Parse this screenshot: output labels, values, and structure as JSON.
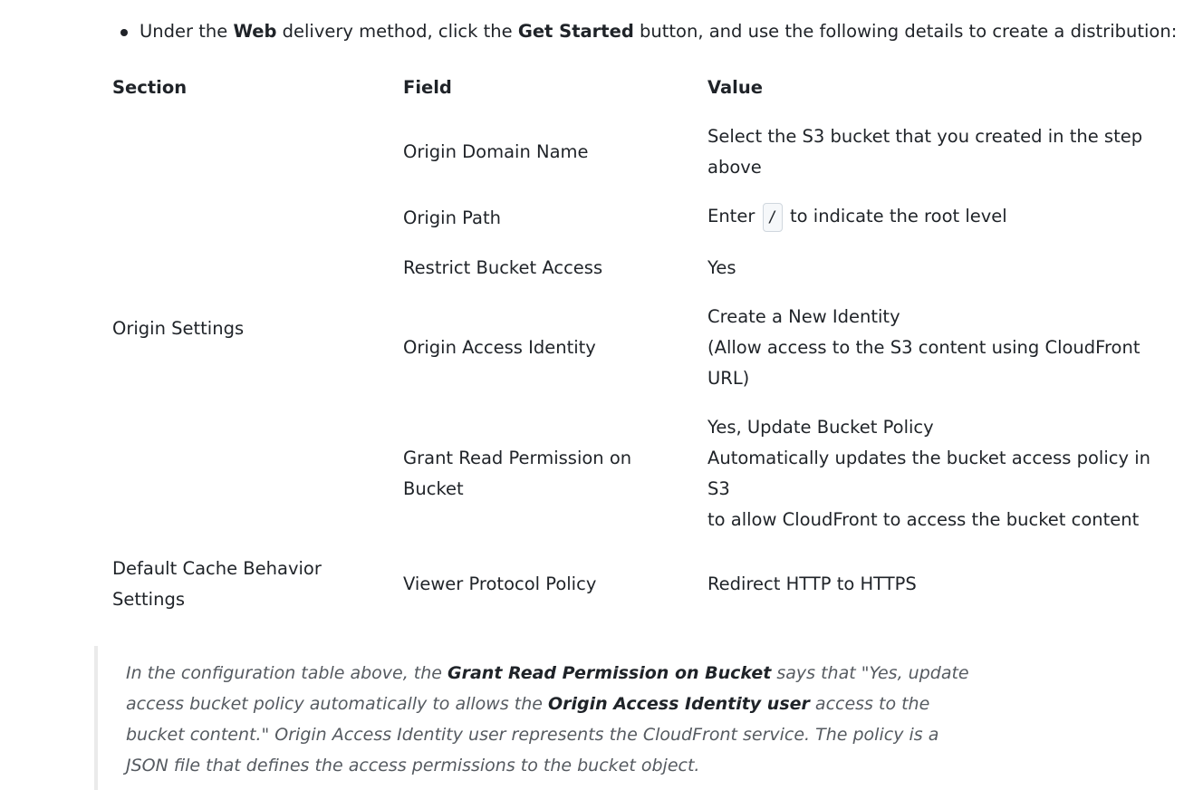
{
  "intro": {
    "prefix": "Under the ",
    "method": "Web",
    "middle": " delivery method, click the ",
    "button": "Get Started",
    "suffix": " button, and use the following details to create a distribution:"
  },
  "table": {
    "headers": [
      "Section",
      "Field",
      "Value"
    ],
    "section_origin": "Origin Settings",
    "section_cache_1": "Default Cache Behavior",
    "section_cache_2": "Settings",
    "rows": [
      {
        "field": "Origin Domain Name",
        "value_1": "Select the S3 bucket that you created in the step",
        "value_2": "above"
      },
      {
        "field": "Origin Path",
        "value_pre": "Enter",
        "value_code": "/",
        "value_post": "to indicate the root level"
      },
      {
        "field": "Restrict Bucket Access",
        "value": "Yes"
      },
      {
        "field": "Origin Access Identity",
        "value_1": "Create a New Identity",
        "value_2": "(Allow access to the S3 content using CloudFront",
        "value_3": "URL)"
      },
      {
        "field_1": "Grant Read Permission on",
        "field_2": "Bucket",
        "value_1": "Yes, Update Bucket Policy",
        "value_2": "Automatically updates the bucket access policy in",
        "value_3": "S3",
        "value_4": "to allow CloudFront to access the bucket content"
      },
      {
        "field": "Viewer Protocol Policy",
        "value": "Redirect HTTP to HTTPS"
      }
    ]
  },
  "note": {
    "t1": "In the configuration table above, the ",
    "b1": "Grant Read Permission on Bucket",
    "t2": " says that \"Yes, update access bucket policy automatically to allows the ",
    "b2": "Origin Access Identity user",
    "t3": " access to the bucket content.\" Origin Access Identity user represents the CloudFront service. The policy is a JSON file that defines the access permissions to the bucket object."
  }
}
